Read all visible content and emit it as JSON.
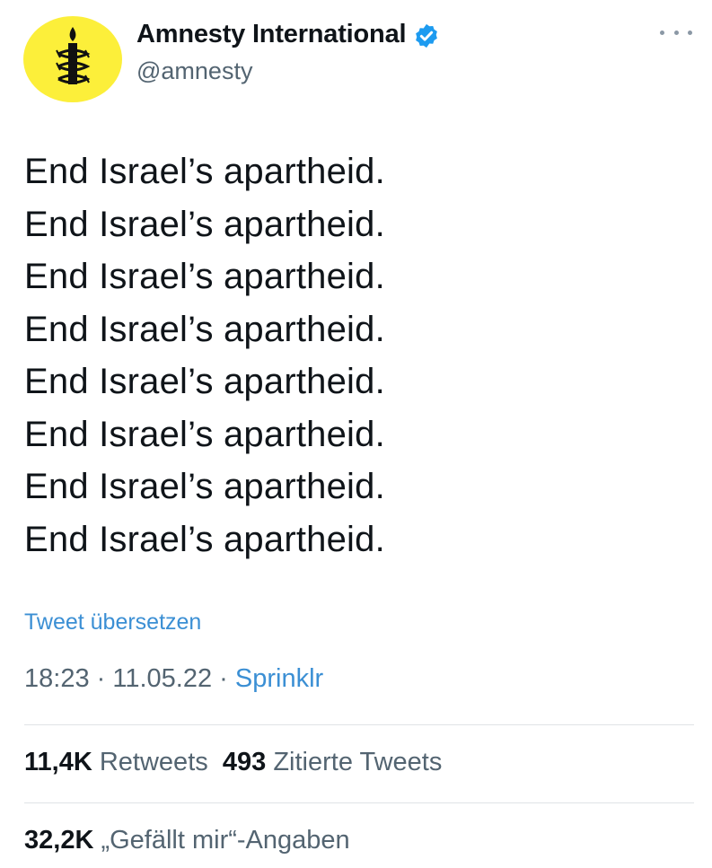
{
  "author": {
    "name": "Amnesty International",
    "handle": "@amnesty",
    "avatar_color": "#fcef3a",
    "verified": true,
    "verified_color": "#1d9bf0"
  },
  "tweet": {
    "lines": [
      "End Israel’s apartheid.",
      "End Israel’s apartheid.",
      "End Israel’s apartheid.",
      "End Israel’s apartheid.",
      "End Israel’s apartheid.",
      "End Israel’s apartheid.",
      "End Israel’s apartheid.",
      "End Israel’s apartheid."
    ],
    "translate_label": "Tweet übersetzen",
    "time": "18:23",
    "date": "11.05.22",
    "separator": " · ",
    "source": "Sprinklr"
  },
  "stats": {
    "retweets_count": "11,4K",
    "retweets_label": "Retweets",
    "quotes_count": "493",
    "quotes_label": "Zitierte Tweets",
    "likes_count": "32,2K",
    "likes_label": "„Gefällt mir“-Angaben"
  },
  "colors": {
    "link": "#3b8fd4",
    "secondary_text": "#536471",
    "primary_text": "#0f1419"
  }
}
